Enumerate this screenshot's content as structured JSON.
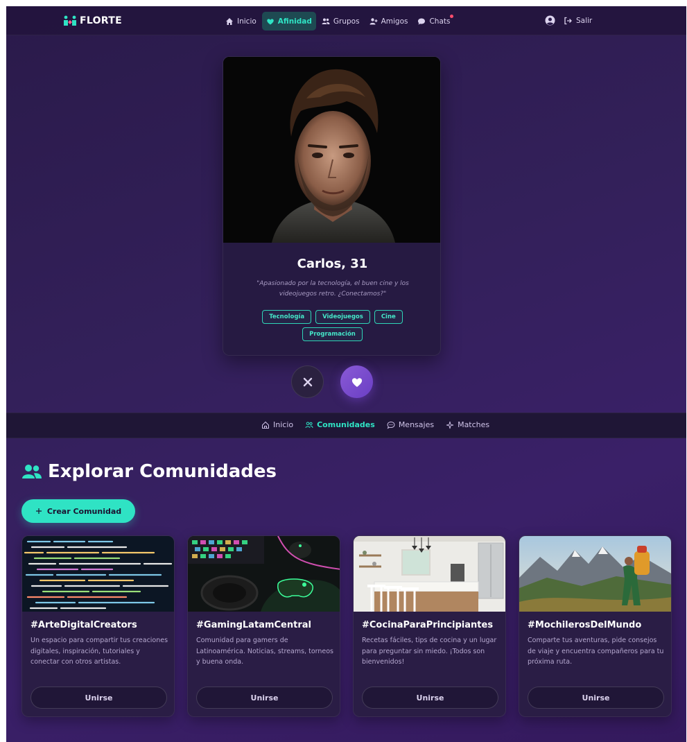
{
  "topnav": {
    "brand": "FLORTE",
    "links": [
      {
        "label": "Inicio",
        "icon": "home-icon",
        "active": false
      },
      {
        "label": "Afinidad",
        "icon": "heart-icon",
        "active": true
      },
      {
        "label": "Grupos",
        "icon": "users-icon",
        "active": false
      },
      {
        "label": "Amigos",
        "icon": "user-plus-icon",
        "active": false
      },
      {
        "label": "Chats",
        "icon": "chat-bubble-icon",
        "active": false
      }
    ],
    "logout_label": "Salir"
  },
  "profile": {
    "name": "Carlos, 31",
    "bio": "\"Apasionado por la tecnología, el buen cine y los videojuegos retro. ¿Conectamos?\"",
    "tags": [
      "Tecnología",
      "Videojuegos",
      "Cine",
      "Programación"
    ]
  },
  "subnav": {
    "items": [
      {
        "label": "Inicio",
        "icon": "home-outline-icon",
        "active": false
      },
      {
        "label": "Comunidades",
        "icon": "people-icon",
        "active": true
      },
      {
        "label": "Mensajes",
        "icon": "message-icon",
        "active": false
      },
      {
        "label": "Matches",
        "icon": "sparkle-icon",
        "active": false
      }
    ]
  },
  "explore": {
    "title": "Explorar Comunidades",
    "create_label": "Crear Comunidad",
    "communities": [
      {
        "title": "#ArteDigitalCreators",
        "desc": "Un espacio para compartir tus creaciones digitales, inspiración, tutoriales y conectar con otros artistas.",
        "join": "Unirse"
      },
      {
        "title": "#GamingLatamCentral",
        "desc": "Comunidad para gamers de Latinoamérica. Noticias, streams, torneos y buena onda.",
        "join": "Unirse"
      },
      {
        "title": "#CocinaParaPrincipiantes",
        "desc": "Recetas fáciles, tips de cocina y un lugar para preguntar sin miedo. ¡Todos son bienvenidos!",
        "join": "Unirse"
      },
      {
        "title": "#MochilerosDelMundo",
        "desc": "Comparte tus aventuras, pide consejos de viaje y encuentra compañeros para tu próxima ruta.",
        "join": "Unirse"
      }
    ]
  },
  "colors": {
    "accent": "#2fe3c4",
    "like": "#7a4bd0",
    "background": "#2d1b4e"
  }
}
